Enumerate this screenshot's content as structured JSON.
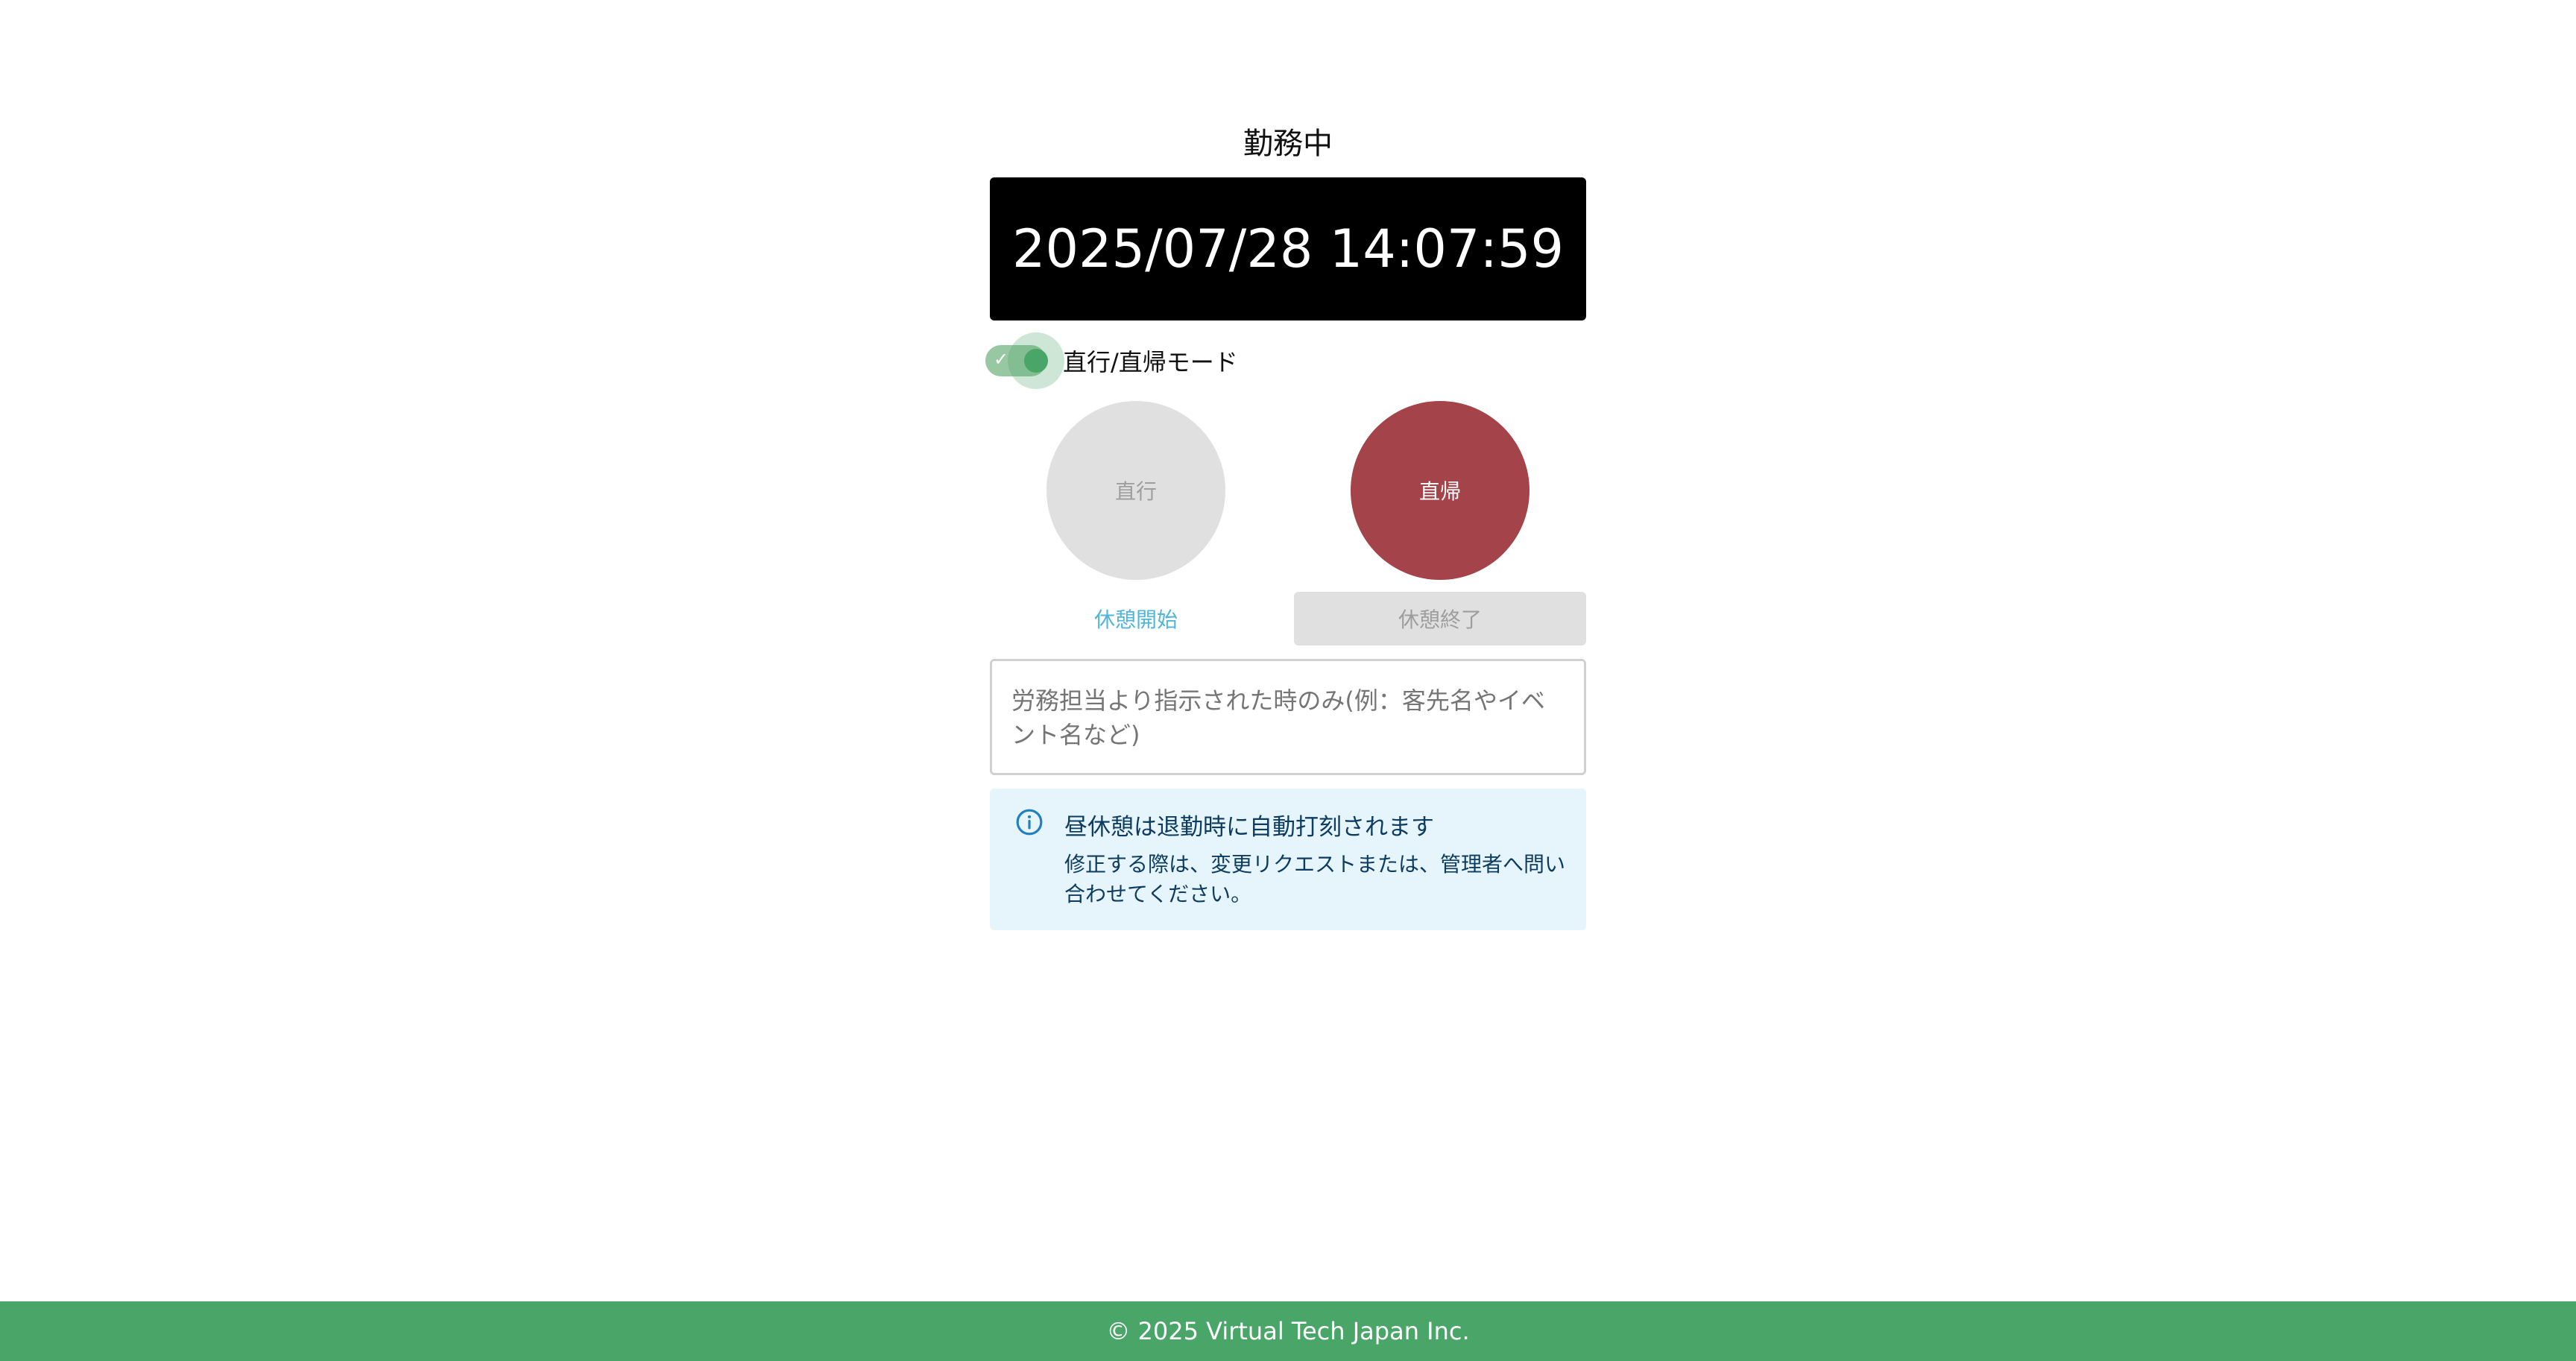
{
  "status": {
    "title": "勤務中"
  },
  "clock": {
    "datetime": "2025/07/28 14:07:59"
  },
  "mode_toggle": {
    "label": "直行/直帰モード",
    "checked": true,
    "check_glyph": "✓"
  },
  "actions": {
    "direct_go_label": "直行",
    "direct_return_label": "直帰",
    "break_start_label": "休憩開始",
    "break_end_label": "休憩終了"
  },
  "note": {
    "placeholder": "労務担当より指示された時のみ(例：客先名やイベント名など)",
    "value": ""
  },
  "info": {
    "icon": "info-icon",
    "title": "昼休憩は退勤時に自動打刻されます",
    "body": "修正する際は、変更リクエストまたは、管理者へ問い合わせてください。"
  },
  "footer": {
    "copyright": "© 2025 Virtual Tech Japan Inc."
  },
  "colors": {
    "accent_green": "#4aa568",
    "direct_return_red": "#a4434a",
    "break_start_blue": "#4fb6d9",
    "info_bg": "#e6f4fb",
    "info_text": "#0d3c61"
  }
}
